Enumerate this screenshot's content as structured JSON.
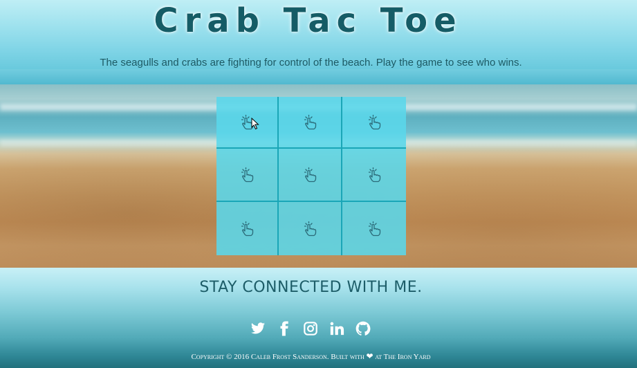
{
  "header": {
    "title": "Crab Tac Toe",
    "subtitle": "The seagulls and crabs are fighting for control of the beach. Play the game to see who wins."
  },
  "board": {
    "cells": [
      {
        "icon": "tap-hand-icon"
      },
      {
        "icon": "tap-hand-icon"
      },
      {
        "icon": "tap-hand-icon"
      },
      {
        "icon": "tap-hand-icon"
      },
      {
        "icon": "tap-hand-icon"
      },
      {
        "icon": "tap-hand-icon"
      },
      {
        "icon": "tap-hand-icon"
      },
      {
        "icon": "tap-hand-icon"
      },
      {
        "icon": "tap-hand-icon"
      }
    ]
  },
  "footer": {
    "stay_connected": "STAY CONNECTED WITH ME.",
    "social": [
      "twitter-icon",
      "facebook-icon",
      "instagram-icon",
      "linkedin-icon",
      "github-icon"
    ],
    "copyright_pre": "Copyright © 2016 Caleb Frost Sanderson. Built with",
    "copyright_post": "at The Iron Yard"
  },
  "colors": {
    "title": "#155c66",
    "board": "#5ad7eb",
    "grid_line": "#1aa6b7"
  }
}
